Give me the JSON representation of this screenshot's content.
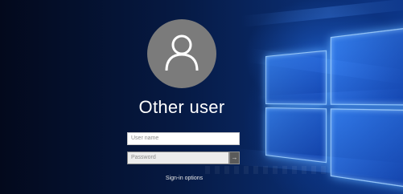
{
  "login": {
    "account_name": "Other user",
    "username_placeholder": "User name",
    "password_placeholder": "Password",
    "submit_glyph": "→",
    "signin_options_label": "Sign-in options"
  },
  "icons": {
    "avatar": "person-icon",
    "submit": "arrow-right-icon"
  },
  "colors": {
    "avatar_circle": "#7b7b7b",
    "background_dark": "#03091c",
    "background_glow": "#0c3588",
    "logo_light": "#3c8cff"
  }
}
